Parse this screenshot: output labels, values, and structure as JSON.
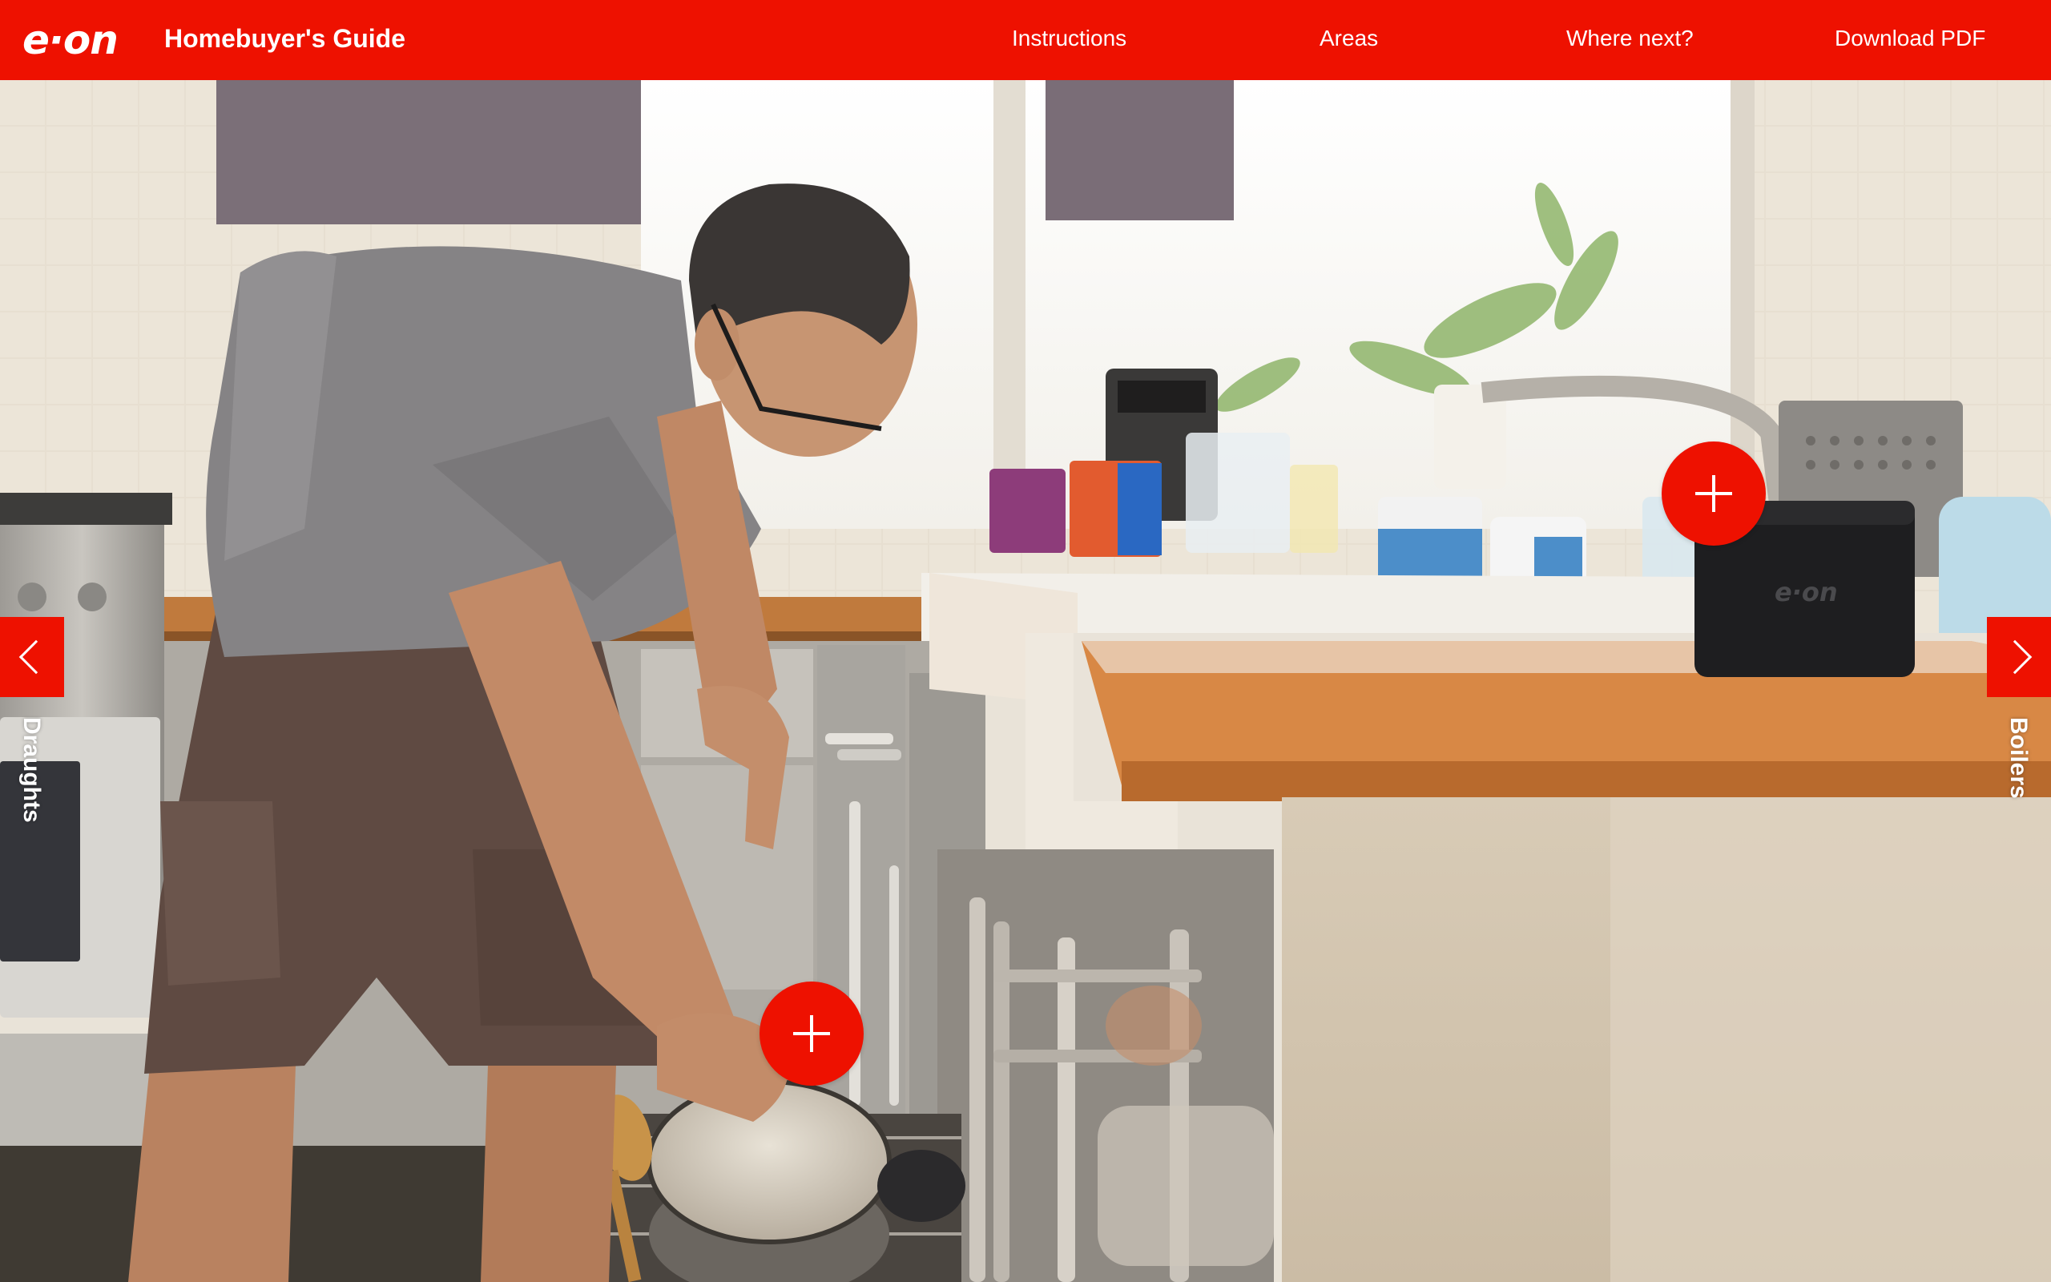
{
  "header": {
    "logo_text": "e·on",
    "title": "Homebuyer's Guide",
    "nav": [
      {
        "label": "Instructions"
      },
      {
        "label": "Areas"
      },
      {
        "label": "Where next?"
      },
      {
        "label": "Download PDF"
      }
    ]
  },
  "scene": {
    "device_logo_text": "e·on",
    "hotspots": [
      {
        "icon": "plus-icon"
      },
      {
        "icon": "plus-icon"
      }
    ]
  },
  "side_nav": {
    "previous": {
      "label": "Draughts",
      "icon": "chevron-left-icon"
    },
    "next": {
      "label": "Boilers",
      "icon": "chevron-right-icon"
    }
  },
  "colors": {
    "brand_red": "#ee1100",
    "text_on_brand": "#ffffff"
  }
}
